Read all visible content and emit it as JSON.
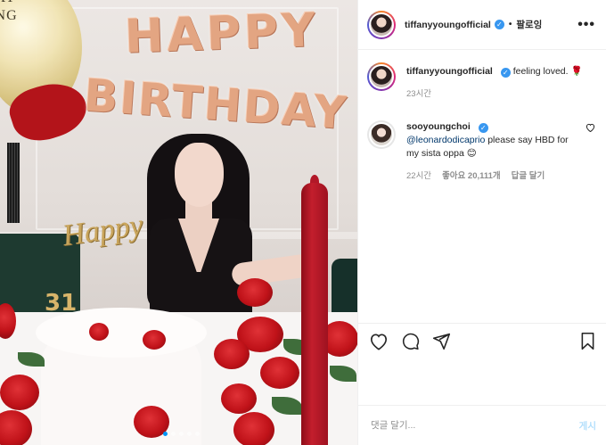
{
  "header": {
    "username": "tiffanyyoungofficial",
    "separator": "•",
    "follow_label": "팔로잉",
    "more_icon": "more-icon"
  },
  "photo": {
    "balloon_text_line1": "DAY",
    "balloon_text_line2": "UNG",
    "banner_word1": "HAPPY",
    "banner_word2": "BIRTHDAY",
    "topper_text": "Happy",
    "topper_text2": "31",
    "carousel_dots": 5,
    "carousel_active": 1
  },
  "comments": [
    {
      "username": "tiffanyyoungofficial",
      "text": "feeling loved.",
      "emoji": "🌹",
      "time": "23시간"
    },
    {
      "username": "sooyoungchoi",
      "mention": "@leonardodicaprio",
      "text": " please say HBD for my sista oppa 😊",
      "time": "22시간",
      "likes": "좋아요 20,111개",
      "reply": "답글 달기"
    }
  ],
  "actions": {
    "like_icon": "heart-icon",
    "comment_icon": "comment-icon",
    "share_icon": "share-icon",
    "save_icon": "bookmark-icon"
  },
  "add_comment": {
    "placeholder": "댓글 달기...",
    "post_label": "게시"
  },
  "colors": {
    "link": "#00376b",
    "verified": "#3897f0",
    "post_button_disabled": "#b2dffc",
    "border": "#efefef"
  }
}
